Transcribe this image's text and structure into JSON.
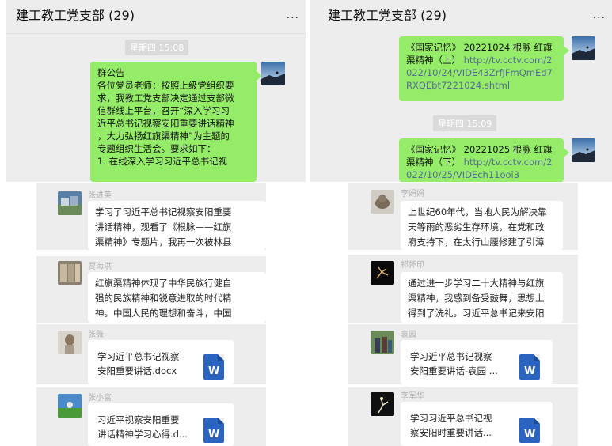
{
  "left_panel": {
    "header": {
      "title": "建工教工党支部 (29)",
      "more": "..."
    },
    "time": "星期四 15:08",
    "notice": {
      "lines": [
        "群公告",
        "各位党员老师：按照上级党组织要",
        "求，我教工党支部决定通过支部微",
        "信群线上平台，召开“深入学习习",
        "近平总书记视察安阳重要讲话精神",
        "，大力弘扬红旗渠精神”为主题的",
        "专题组织生活会。要求如下：",
        "    1. 在线深入学习习近平总书记视"
      ]
    }
  },
  "right_panel": {
    "header": {
      "title": "建工教工党支部 (29)",
      "more": "..."
    },
    "msg1": {
      "lines": [
        "《国家记忆》 20221024 根脉 红旗",
        "渠精神（上） "
      ],
      "link_lines": [
        "http://tv.cctv.com/2",
        "022/10/24/VIDE43ZrfJFmQmEd7",
        "RXQEbt7221024.shtml"
      ]
    },
    "time": "星期四 15:09",
    "msg2": {
      "lines": [
        "《国家记忆》 20221025 根脉 红旗",
        "渠精神（下） "
      ],
      "link_lines": [
        "http://tv.cctv.com/2",
        "022/10/25/VIDEch11ooi3"
      ]
    }
  },
  "cards": [
    {
      "name": "张进英",
      "lines": [
        "学习了习近平总书记视察安阳重要",
        "讲话精神，观看了《根脉——红旗",
        "渠精神》专题片，我再一次被林县"
      ]
    },
    {
      "name": "贾海洪",
      "lines": [
        "红旗渠精神体现了中华民族行健自",
        "强的民族精神和锐意进取的时代精",
        "神。中国人民的理想和奋斗，中国"
      ]
    },
    {
      "name": "张薇",
      "file": [
        "学习近平总书记视察",
        "安阳重要讲话.docx"
      ],
      "icon": "W"
    },
    {
      "name": "张小富",
      "file": [
        "习近平视察安阳重要",
        "讲话精神学习心得.d..."
      ],
      "icon": "W"
    },
    {
      "name": "李娟娟",
      "lines": [
        "上世纪60年代，当地人民为解决靠",
        "天等雨的恶劣生存环境，在党和政",
        "府支持下，在太行山腰修建了引漳"
      ]
    },
    {
      "name": "祁怀印",
      "lines": [
        "通过进一步学习二十大精神与红旗",
        "渠精神，我感到备受鼓舞，思想上",
        "得到了洗礼。习近平总书记来安阳"
      ]
    },
    {
      "name": "袁园",
      "file": [
        "学习近平总书记视察",
        "安阳重要讲话-袁园 ..."
      ],
      "icon": "W"
    },
    {
      "name": "李军华",
      "file": [
        "学习习近平总书记视",
        "察安阳时重要讲话..."
      ],
      "icon": "W"
    }
  ]
}
